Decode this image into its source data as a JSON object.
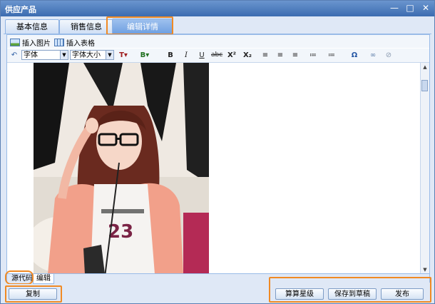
{
  "window": {
    "title": "供应产品",
    "controls": [
      "—",
      "□",
      "✕"
    ]
  },
  "tabs": [
    {
      "label": "基本信息"
    },
    {
      "label": "销售信息"
    },
    {
      "label": "编辑详情",
      "active": true
    }
  ],
  "toolbar_insert": {
    "image_label": "插入图片",
    "table_label": "插入表格"
  },
  "toolbar_format": {
    "font_family": "字体",
    "font_size": "字体大小",
    "buttons": [
      "B",
      "I",
      "U",
      "abc",
      "X²",
      "X₂",
      "≡",
      "≡",
      "≡",
      "≔",
      "≔",
      "Ω",
      "∞",
      "⊘"
    ]
  },
  "bottom_tabs": {
    "source_label": "源代码",
    "edit_label": "编辑"
  },
  "footer": {
    "copy_label": "复制",
    "rate_label": "算算星级",
    "draft_label": "保存到草稿",
    "publish_label": "发布"
  },
  "colors": {
    "highlight": "#f08a24",
    "title_bar": "#4a7bc0"
  }
}
